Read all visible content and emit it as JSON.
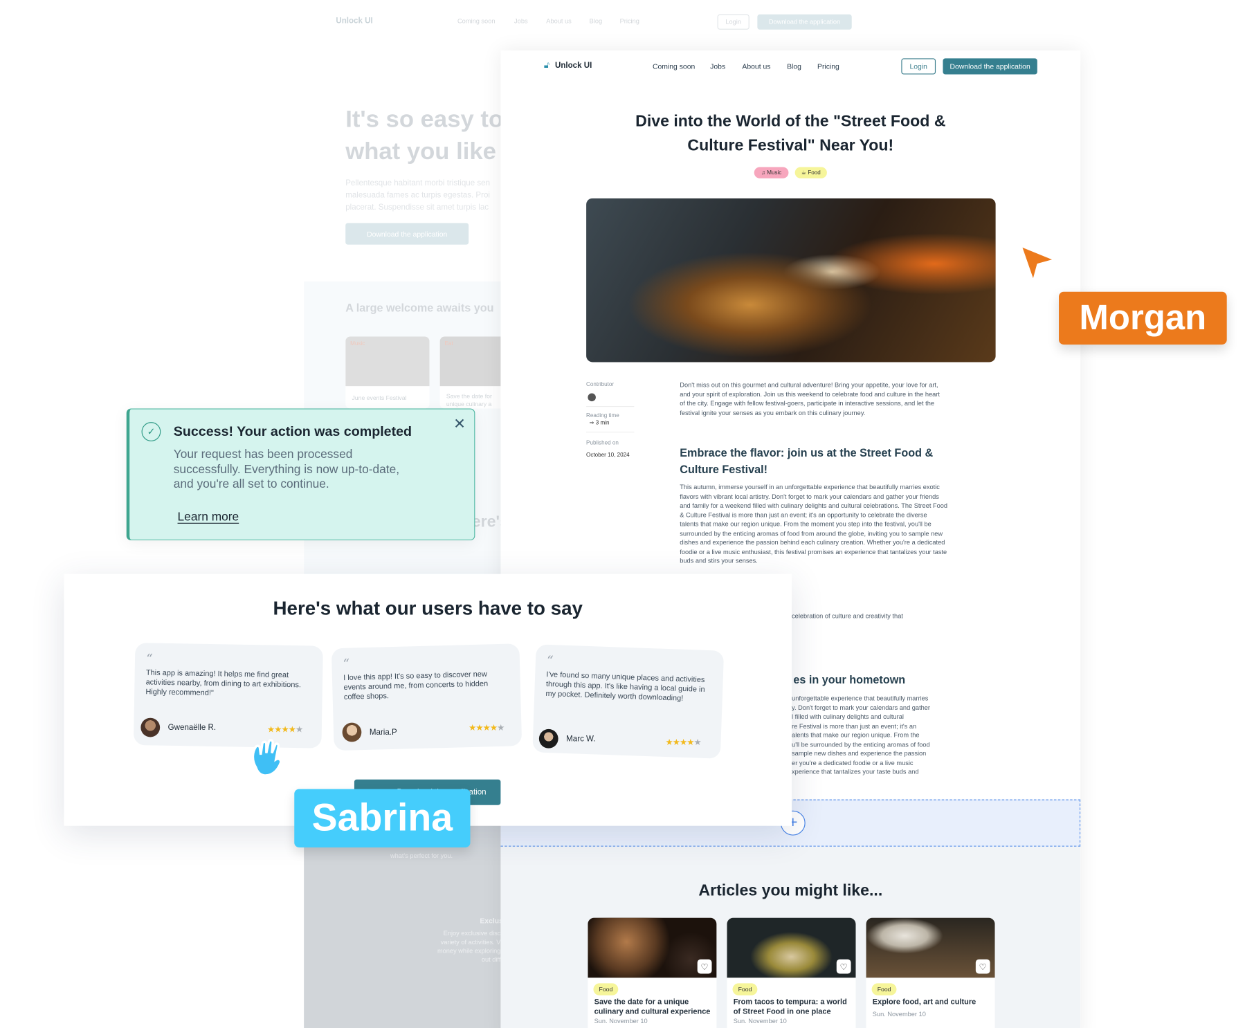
{
  "background_page": {
    "logo": "Unlock UI",
    "nav": [
      "Coming soon",
      "Jobs",
      "About us",
      "Blog",
      "Pricing"
    ],
    "login": "Login",
    "download": "Download the application",
    "hero_line1": "It's so easy to",
    "hero_line2": "what you like",
    "hero_text": [
      "Pellentesque habitant morbi tristique sen",
      "malesuada fames ac turpis egestas. Proi",
      "placerat. Suspendisse sit amet turpis lac"
    ],
    "hero_button": "Download the application",
    "welcome_title": "A large welcome awaits you",
    "cards": [
      {
        "tag": "Music",
        "title": "June events Festival"
      },
      {
        "tag": "Eat",
        "title": "Save the date for unique culinary a"
      }
    ],
    "partial_heading": "ere's",
    "gray_section": {
      "line": "what's perfect for you.",
      "heading": "Exclus",
      "text": [
        "Enjoy exclusive disc",
        "variety of activities. V",
        "money while exploring",
        "out diff"
      ]
    }
  },
  "main_page": {
    "logo": "Unlock UI",
    "nav": [
      "Coming soon",
      "Jobs",
      "About us",
      "Blog",
      "Pricing"
    ],
    "login": "Login",
    "download": "Download the application",
    "title_line1": "Dive into the World of the \"Street Food &",
    "title_line2": "Culture Festival\" Near You!",
    "tags": [
      {
        "label": "Music",
        "color": "#f7a6bd",
        "icon": "music-icon"
      },
      {
        "label": "Food",
        "color": "#f6f59a",
        "icon": "food-icon"
      }
    ],
    "meta": {
      "contributor_label": "Contributor",
      "reading_label": "Reading time",
      "reading_value": "3 min",
      "published_label": "Published on",
      "published_value": "October 10, 2024"
    },
    "intro": "Don't miss out on this gourmet and cultural adventure! Bring your appetite, your love for art, and your spirit of exploration. Join us this weekend to celebrate food and culture in the heart of the city. Engage with fellow festival-goers, participate in interactive sessions, and let the festival ignite your senses as you embark on this culinary journey.",
    "heading1": "Embrace the flavor: join us at the Street Food & Culture Festival!",
    "para1": "This autumn, immerse yourself in an unforgettable experience that beautifully marries exotic flavors with vibrant local artistry. Don't forget to mark your calendars and gather your friends and family for a weekend filled with culinary delights and cultural celebrations. The Street Food & Culture Festival is more than just an event; it's an opportunity to celebrate the diverse talents that make our region unique. From the moment you step into the festival, you'll be surrounded by the enticing aromas of food from around the globe, inviting you to sample new dishes and experience the passion behind each culinary creation. Whether you're a dedicated foodie or a live music enthusiast, this festival promises an experience that tantalizes your taste buds and stirs your senses.",
    "partial_line": "celebration of culture and creativity that",
    "heading2_partial": "es in your hometown",
    "para2_partial": [
      "unforgettable experience that beautifully marries",
      "y. Don't forget to mark your calendars and gather",
      "l filled with culinary delights and cultural",
      "re Festival is more than just an event; it's an",
      "alents that make our region unique. From the",
      "u'll be surrounded by the enticing aromas of food",
      "sample new dishes and experience the passion",
      "er you're a dedicated foodie or a live music",
      "xperience that tantalizes your taste buds and"
    ],
    "articles_title": "Articles you might like...",
    "articles": [
      {
        "tag": "Food",
        "title": "Save the date for a unique culinary and cultural experience",
        "date": "Sun. November 10"
      },
      {
        "tag": "Food",
        "title": "From tacos to tempura: a world of Street Food in one place",
        "date": "Sun. November 10"
      },
      {
        "tag": "Food",
        "title": "Explore food, art and culture",
        "date": "Sun. November 10"
      }
    ]
  },
  "toast": {
    "title": "Success! Your action was completed",
    "body": "Your request has been processed successfully. Everything is now up-to-date, and you're all set to continue.",
    "link": "Learn more",
    "accent": "#4db6a0",
    "bg": "#d5f4ee"
  },
  "testimonials": {
    "title": "Here's what our users have to say",
    "items": [
      {
        "text": "This app is amazing! It helps me find great activities nearby, from dining to art exhibitions. Highly recommend!\"",
        "name": "Gwenaëlle R.",
        "rating": 4
      },
      {
        "text": "I love this app! It's so easy to discover new events around me, from concerts to hidden coffee shops.",
        "name": "Maria.P",
        "rating": 4
      },
      {
        "text": "I've found so many unique places and activities through this app. It's like having a local guide in my pocket. Definitely worth downloading!",
        "name": "Marc W.",
        "rating": 4
      }
    ],
    "button": "Download the application"
  },
  "cursors": [
    {
      "name": "Morgan",
      "color": "#ec7a1c"
    },
    {
      "name": "Sabrina",
      "color": "#45cdfc"
    }
  ]
}
